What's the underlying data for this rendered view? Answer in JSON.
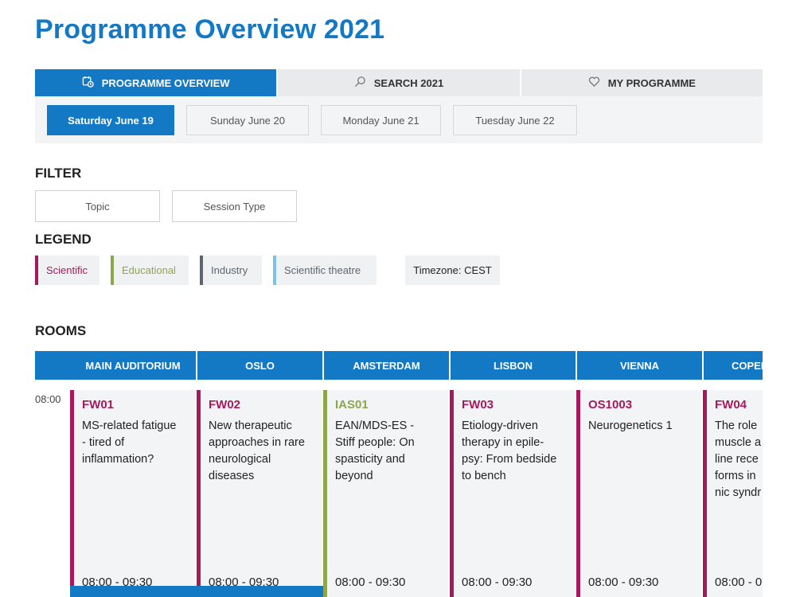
{
  "page": {
    "title": "Programme Overview 2021"
  },
  "colors": {
    "accent": "#1479c4",
    "scientific": "#a6195d",
    "educational": "#8da64c",
    "industry": "#5c6670",
    "scientific_theatre": "#7cc2e8"
  },
  "tabs": [
    {
      "label": "PROGRAMME OVERVIEW",
      "icon": "calendar-clock-icon",
      "active": true
    },
    {
      "label": "SEARCH 2021",
      "icon": "search-icon",
      "active": false
    },
    {
      "label": "MY PROGRAMME",
      "icon": "heart-icon",
      "active": false
    }
  ],
  "days": [
    {
      "label": "Saturday June 19",
      "active": true
    },
    {
      "label": "Sunday June 20",
      "active": false
    },
    {
      "label": "Monday June 21",
      "active": false
    },
    {
      "label": "Tuesday June 22",
      "active": false
    }
  ],
  "filter": {
    "heading": "FILTER",
    "topic_label": "Topic",
    "session_type_label": "Session Type"
  },
  "legend": {
    "heading": "LEGEND",
    "items": [
      {
        "label": "Scientific",
        "color": "#a6195d"
      },
      {
        "label": "Educational",
        "color": "#8da64c"
      },
      {
        "label": "Industry",
        "color": "#5c6670"
      },
      {
        "label": "Scientific theatre",
        "color": "#7cc2e8"
      }
    ],
    "timezone": "Timezone: CEST"
  },
  "rooms": {
    "heading": "ROOMS",
    "columns": [
      "MAIN AUDITORIUM",
      "OSLO",
      "AMSTERDAM",
      "LISBON",
      "VIENNA",
      "COPENHAGEN"
    ]
  },
  "schedule": {
    "time_label": "08:00",
    "sessions": [
      {
        "code": "FW01",
        "title_lines": [
          "MS-related fatigue",
          "- tired of",
          "inflammation?"
        ],
        "time": "08:00 - 09:30",
        "color": "#a6195d"
      },
      {
        "code": "FW02",
        "title_lines": [
          "New therapeutic",
          "approaches in rare",
          "neurological",
          "diseases"
        ],
        "time": "08:00 - 09:30",
        "color": "#a6195d"
      },
      {
        "code": "IAS01",
        "title_lines": [
          "EAN/MDS-ES -",
          "Stiff people: On",
          "spasticity and",
          "beyond"
        ],
        "time": "08:00 - 09:30",
        "color": "#8da64c"
      },
      {
        "code": "FW03",
        "title_lines": [
          "Etiology-driven",
          "therapy in epile-",
          "psy: From bedside",
          "to bench"
        ],
        "time": "08:00 - 09:30",
        "color": "#a6195d"
      },
      {
        "code": "OS1003",
        "title_lines": [
          "Neurogenetics 1"
        ],
        "time": "08:00 - 09:30",
        "color": "#a6195d"
      },
      {
        "code": "FW04",
        "title_lines": [
          "The role",
          "muscle a",
          "line rece",
          "forms in",
          "nic syndr"
        ],
        "time": "08:00 - 0",
        "color": "#a6195d"
      }
    ]
  }
}
